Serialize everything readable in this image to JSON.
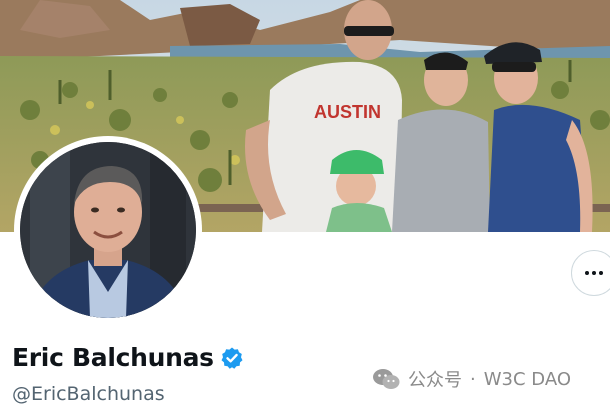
{
  "profile": {
    "display_name": "Eric Balchunas",
    "handle": "@EricBalchunas",
    "verified": true,
    "banner_shirt_text": "AUSTIN"
  },
  "actions": {
    "more_icon": "more-horizontal-icon"
  },
  "watermark": {
    "source": "公众号",
    "separator": "·",
    "account": "W3C DAO",
    "icon": "wechat-icon"
  },
  "colors": {
    "verified_blue": "#1d9bf0",
    "name_text": "#0f1419",
    "handle_text": "#536471"
  }
}
